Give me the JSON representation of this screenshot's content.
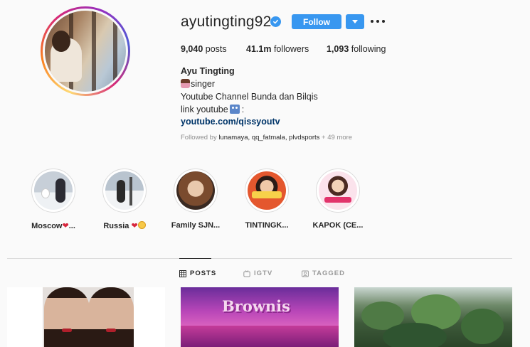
{
  "profile": {
    "username": "ayutingting92",
    "verified": true,
    "follow_label": "Follow",
    "stats": {
      "posts": "9,040",
      "posts_label": "posts",
      "followers": "41.1m",
      "followers_label": "followers",
      "following": "1,093",
      "following_label": "following"
    },
    "full_name": "Ayu Tingting",
    "bio_line1": "singer",
    "bio_line2": "Youtube Channel Bunda dan Bilqis",
    "bio_line3": "link youtube",
    "bio_line3_suffix": ":",
    "link": "youtube.com/qissyoutv",
    "followed_by_prefix": "Followed by",
    "followed_by_names": "lunamaya, qq_fatmala, plvdsports",
    "followed_by_more": "+ 49 more"
  },
  "highlights": [
    {
      "label": "Moscow",
      "suffix": "..."
    },
    {
      "label": "Russia"
    },
    {
      "label": "Family SJN..."
    },
    {
      "label": "TINTINGK..."
    },
    {
      "label": "KAPOK (CE..."
    }
  ],
  "tabs": [
    {
      "label": "POSTS",
      "icon": "grid-icon",
      "active": true
    },
    {
      "label": "IGTV",
      "icon": "igtv-icon",
      "active": false
    },
    {
      "label": "TAGGED",
      "icon": "tag-icon",
      "active": false
    }
  ],
  "posts": {
    "post2_banner": "Brownis"
  },
  "colors": {
    "accent": "#3897f0",
    "link": "#003569",
    "text": "#262626",
    "muted": "#8e8e8e"
  }
}
